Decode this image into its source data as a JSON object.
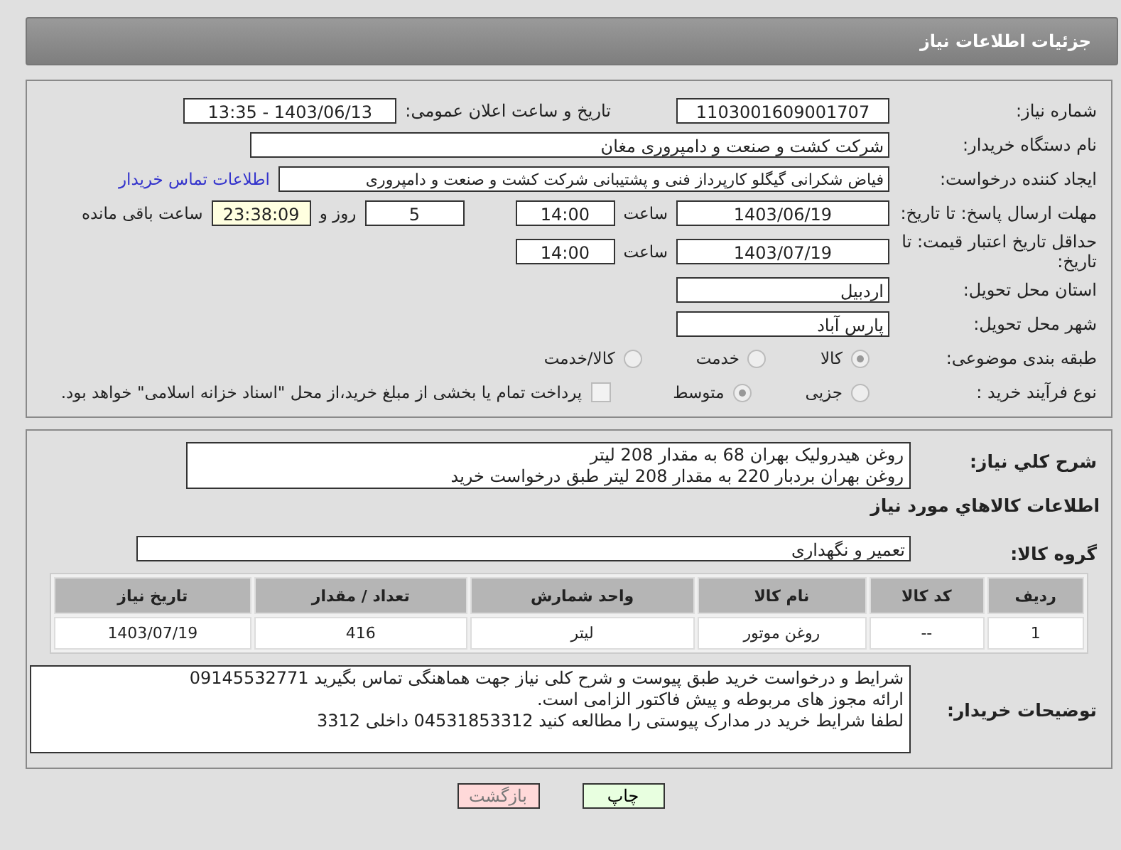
{
  "header": {
    "title": "جزئیات اطلاعات نیاز"
  },
  "need_number": {
    "label": "شماره نیاز:",
    "value": "1103001609001707"
  },
  "announce": {
    "label": "تاریخ و ساعت اعلان عمومی:",
    "value": "1403/06/13 - 13:35"
  },
  "buyer": {
    "label": "نام دستگاه خریدار:",
    "value": "شرکت کشت و صنعت و دامپروری مغان"
  },
  "creator": {
    "label": "ایجاد کننده درخواست:",
    "value": "فیاض شکرانی گیگلو کارپرداز فنی و پشتیبانی شرکت کشت و صنعت و دامپروری",
    "link": "اطلاعات تماس خریدار"
  },
  "deadline": {
    "label": "مهلت ارسال پاسخ: تا تاریخ:",
    "date": "1403/06/19",
    "time_label": "ساعت",
    "time": "14:00",
    "days": "5",
    "days_label": "روز و",
    "remaining": "23:38:09",
    "remaining_label": "ساعت باقی مانده"
  },
  "validity": {
    "label": "حداقل تاریخ اعتبار قیمت: تا تاریخ:",
    "date": "1403/07/19",
    "time_label": "ساعت",
    "time": "14:00"
  },
  "province": {
    "label": "استان محل تحویل:",
    "value": "اردبیل"
  },
  "city": {
    "label": "شهر محل تحویل:",
    "value": "پارس آباد"
  },
  "category": {
    "label": "طبقه بندی موضوعی:",
    "options": [
      {
        "label": "کالا",
        "selected": true
      },
      {
        "label": "خدمت",
        "selected": false
      },
      {
        "label": "کالا/خدمت",
        "selected": false
      }
    ]
  },
  "process": {
    "label": "نوع فرآیند خرید :",
    "options": [
      {
        "label": "جزیی",
        "selected": false
      },
      {
        "label": "متوسط",
        "selected": true
      }
    ],
    "payment": {
      "label": "پرداخت تمام یا بخشی از مبلغ خرید،از محل \"اسناد خزانه اسلامی\" خواهد بود.",
      "checked": false
    }
  },
  "description": {
    "label": "شرح کلي نياز:",
    "lines": [
      "روغن هیدرولیک بهران 68 به مقدار 208 لیتر",
      "روغن بهران بردبار 220 به مقدار 208 لیتر طبق درخواست خرید"
    ]
  },
  "goods_heading": "اطلاعات کالاهاي مورد نياز",
  "goods_group": {
    "label": "گروه کالا:",
    "value": "تعمیر و نگهداری"
  },
  "table": {
    "columns": [
      "ردیف",
      "کد کالا",
      "نام کالا",
      "واحد شمارش",
      "تعداد / مقدار",
      "تاریخ نیاز"
    ],
    "rows": [
      [
        "1",
        "--",
        "روغن موتور",
        "لیتر",
        "416",
        "1403/07/19"
      ]
    ]
  },
  "buyer_notes": {
    "label": "توضیحات خریدار:",
    "lines": [
      "شرایط و درخواست خرید طبق پیوست و شرح کلی نیاز  جهت هماهنگی تماس بگیرید 09145532771",
      "ارائه مجوز های مربوطه و پیش فاکتور الزامی است.",
      "لطفا شرایط خرید در مدارک پیوستی را مطالعه کنید  04531853312   داخلی  3312"
    ]
  },
  "buttons": [
    {
      "label": "چاپ",
      "kind": "print"
    },
    {
      "label": "بازگشت",
      "kind": "back"
    }
  ]
}
